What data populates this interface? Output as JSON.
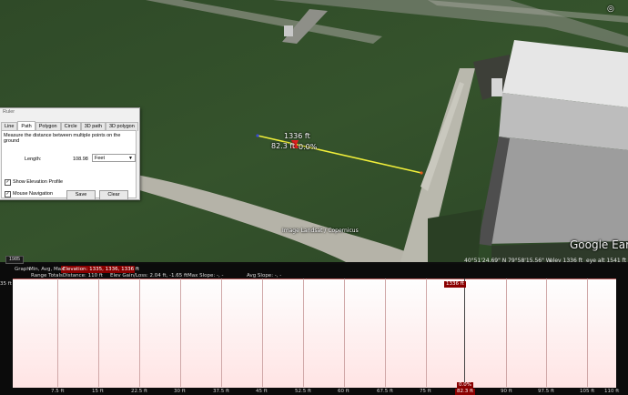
{
  "map": {
    "elev_label": "1336 ft",
    "dist_label": "82.3 ft",
    "grade_label": "0.0%",
    "attribution": "Image Landsat / Copernicus",
    "logo": "Google Earth",
    "year": "1985",
    "coords": "40°51'24.69\" N",
    "lon": "79°58'15.56\" W",
    "elev_status": "elev  1336 ft",
    "eye_alt": "eye alt  1541 ft"
  },
  "ruler": {
    "title": "Ruler",
    "tabs": [
      "Line",
      "Path",
      "Polygon",
      "Circle",
      "3D path",
      "3D polygon"
    ],
    "active_tab": "Path",
    "description": "Measure the distance between multiple points on the ground",
    "length_label": "Length:",
    "length_value": "108.98",
    "unit": "Feet",
    "show_elevation_label": "Show Elevation Profile",
    "mouse_nav_label": "Mouse Navigation",
    "save_label": "Save",
    "clear_label": "Clear"
  },
  "profile": {
    "graph_label": "Graph:",
    "graph_opts": "Min, Avg, Max",
    "elevation": "Elevation: 1335, 1336, 1336 ft",
    "range_totals": "Range Totals:",
    "distance": "Distance: 110 ft",
    "elev_gain": "Elev Gain/Loss: 2.04 ft, -1.65 ft",
    "max_slope": "Max Slope: -, -",
    "avg_slope": "Avg Slope: -, -",
    "y_label": "35 ft",
    "cursor_elev": "1336 ft",
    "cursor_slope": "0.0%",
    "ticks": [
      "7.5 ft",
      "15 ft",
      "22.5 ft",
      "30 ft",
      "37.5 ft",
      "45 ft",
      "52.5 ft",
      "60 ft",
      "67.5 ft",
      "75 ft",
      "82.3 ft",
      "90 ft",
      "97.5 ft",
      "105 ft",
      "110 ft"
    ]
  }
}
